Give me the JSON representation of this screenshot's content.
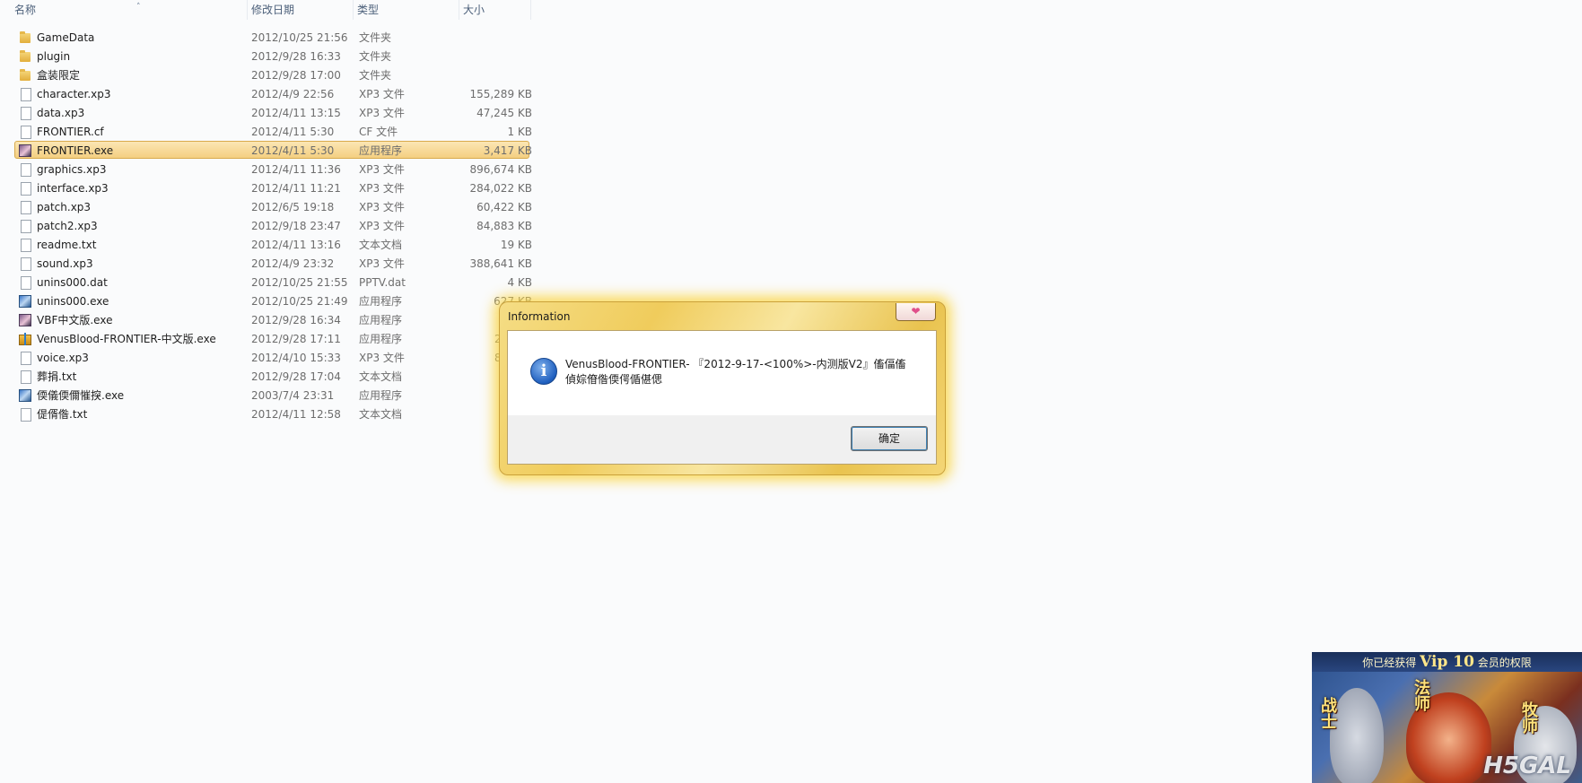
{
  "header": {
    "col_name": "名称",
    "col_date": "修改日期",
    "col_type": "类型",
    "col_size": "大小"
  },
  "files": [
    {
      "name": "GameData",
      "date": "2012/10/25 21:56",
      "type": "文件夹",
      "size": "",
      "icon": "folder-icon"
    },
    {
      "name": "plugin",
      "date": "2012/9/28 16:33",
      "type": "文件夹",
      "size": "",
      "icon": "folder-icon"
    },
    {
      "name": "盒装限定",
      "date": "2012/9/28 17:00",
      "type": "文件夹",
      "size": "",
      "icon": "folder-icon"
    },
    {
      "name": "character.xp3",
      "date": "2012/4/9 22:56",
      "type": "XP3 文件",
      "size": "155,289 KB",
      "icon": "file-icon"
    },
    {
      "name": "data.xp3",
      "date": "2012/4/11 13:15",
      "type": "XP3 文件",
      "size": "47,245 KB",
      "icon": "file-icon"
    },
    {
      "name": "FRONTIER.cf",
      "date": "2012/4/11 5:30",
      "type": "CF 文件",
      "size": "1 KB",
      "icon": "file-icon"
    },
    {
      "name": "FRONTIER.exe",
      "date": "2012/4/11 5:30",
      "type": "应用程序",
      "size": "3,417 KB",
      "icon": "app-icon",
      "selected": true
    },
    {
      "name": "graphics.xp3",
      "date": "2012/4/11 11:36",
      "type": "XP3 文件",
      "size": "896,674 KB",
      "icon": "file-icon"
    },
    {
      "name": "interface.xp3",
      "date": "2012/4/11 11:21",
      "type": "XP3 文件",
      "size": "284,022 KB",
      "icon": "file-icon"
    },
    {
      "name": "patch.xp3",
      "date": "2012/6/5 19:18",
      "type": "XP3 文件",
      "size": "60,422 KB",
      "icon": "file-icon"
    },
    {
      "name": "patch2.xp3",
      "date": "2012/9/18 23:47",
      "type": "XP3 文件",
      "size": "84,883 KB",
      "icon": "file-icon"
    },
    {
      "name": "readme.txt",
      "date": "2012/4/11 13:16",
      "type": "文本文档",
      "size": "19 KB",
      "icon": "file-icon"
    },
    {
      "name": "sound.xp3",
      "date": "2012/4/9 23:32",
      "type": "XP3 文件",
      "size": "388,641 KB",
      "icon": "file-icon"
    },
    {
      "name": "unins000.dat",
      "date": "2012/10/25 21:55",
      "type": "PPTV.dat",
      "size": "4 KB",
      "icon": "file-icon"
    },
    {
      "name": "unins000.exe",
      "date": "2012/10/25 21:49",
      "type": "应用程序",
      "size": "627 KB",
      "icon": "setup-icon"
    },
    {
      "name": "VBF中文版.exe",
      "date": "2012/9/28 16:34",
      "type": "应用程序",
      "size": "3,47",
      "icon": "app-icon"
    },
    {
      "name": "VenusBlood-FRONTIER-中文版.exe",
      "date": "2012/9/28 17:11",
      "type": "应用程序",
      "size": "208,42",
      "icon": "gift-icon"
    },
    {
      "name": "voice.xp3",
      "date": "2012/4/10 15:33",
      "type": "XP3 文件",
      "size": "885,38",
      "icon": "file-icon"
    },
    {
      "name": "葬捐.txt",
      "date": "2012/9/28 17:04",
      "type": "文本文档",
      "size": "",
      "icon": "file-icon"
    },
    {
      "name": "偄儀偄儞慛揬.exe",
      "date": "2003/7/4 23:31",
      "type": "应用程序",
      "size": "1",
      "icon": "setup-icon"
    },
    {
      "name": "偍偦偺.txt",
      "date": "2012/4/11 12:58",
      "type": "文本文档",
      "size": "1",
      "icon": "file-icon"
    }
  ],
  "dialog": {
    "title": "Information",
    "message_line1": "VenusBlood-FRONTIER- 『2012-9-17-<100%>-内测版V2』傗偪傗",
    "message_line2": "偵婃傄偺偄偔偱偡偲",
    "ok_label": "确定",
    "close_glyph": "❤"
  },
  "vip_ad": {
    "text_before": "你已经获得",
    "vip_label": "Vip 10",
    "text_after": "会员的权限",
    "class_left": "战士",
    "class_center": "法师",
    "class_right": "牧师",
    "watermark": "H5GAL"
  },
  "colors": {
    "selected_row": "#f4cf81",
    "dialog_frame": "#f0cc5c"
  }
}
